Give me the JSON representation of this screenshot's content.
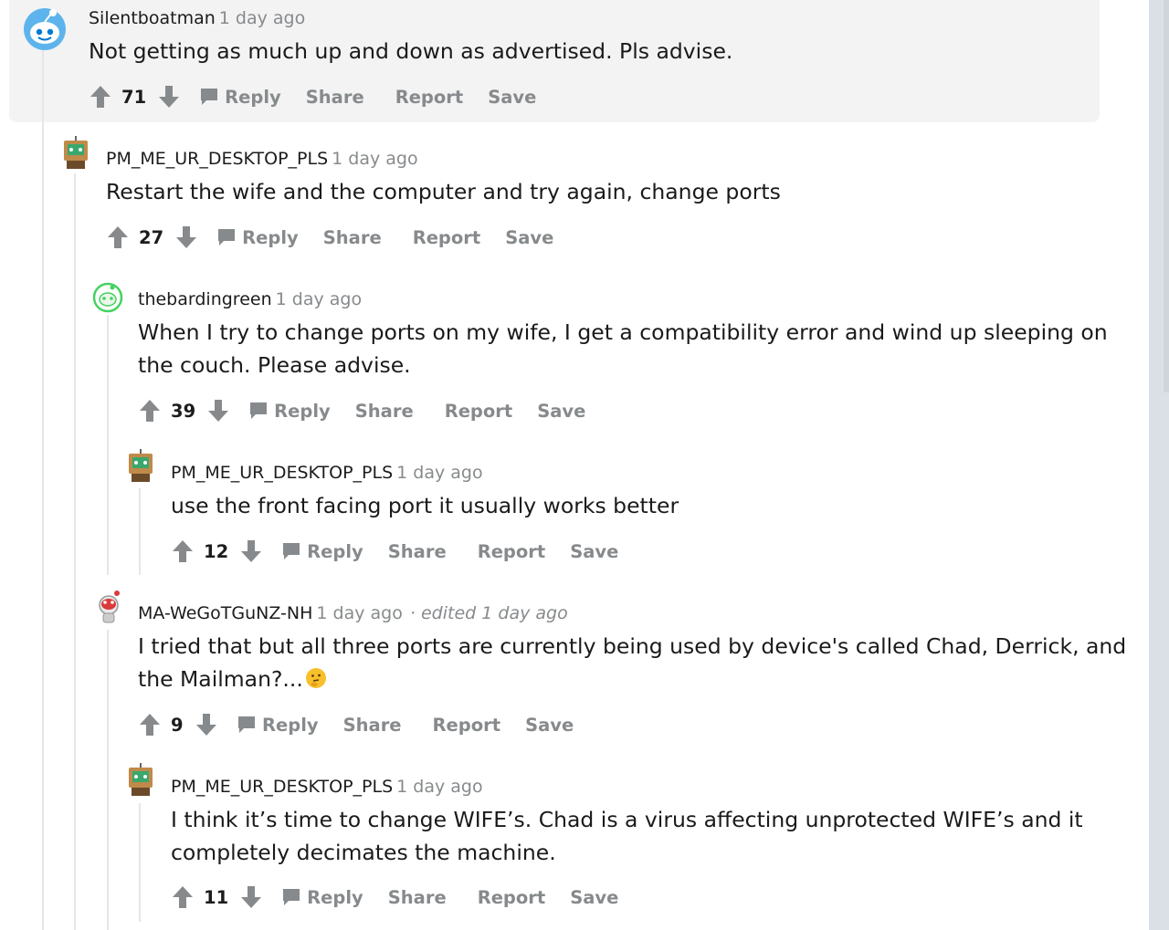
{
  "ui": {
    "reply_label": "Reply",
    "share_label": "Share",
    "report_label": "Report",
    "save_label": "Save",
    "upvote_icon": "upvote-arrow-icon",
    "downvote_icon": "downvote-arrow-icon",
    "reply_icon": "speech-bubble-icon",
    "colors": {
      "meta_gray": "#878a8c",
      "highlight_bg": "#f3f3f3",
      "gutter_bg": "#dae0e6"
    }
  },
  "comments": [
    {
      "author": "Silentboatman",
      "time": "1 day ago",
      "edited": "",
      "lines": [
        "Not getting as much up and down as advertised. Pls advise."
      ],
      "score": "71",
      "avatar": "snoo-blue-avatar"
    },
    {
      "author": "PM_ME_UR_DESKTOP_PLS",
      "time": "1 day ago",
      "edited": "",
      "lines": [
        "Restart the wife and the computer and try again, change ports"
      ],
      "score": "27",
      "avatar": "retro-computer-avatar"
    },
    {
      "author": "thebardingreen",
      "time": "1 day ago",
      "edited": "",
      "lines": [
        "When I try to change ports on my wife, I get a compatibility error and wind up sleeping on",
        "the couch. Please advise."
      ],
      "score": "39",
      "avatar": "snoo-green-avatar"
    },
    {
      "author": "PM_ME_UR_DESKTOP_PLS",
      "time": "1 day ago",
      "edited": "",
      "lines": [
        "use the front facing port it usually works better"
      ],
      "score": "12",
      "avatar": "retro-computer-avatar"
    },
    {
      "author": "MA-WeGoTGuNZ-NH",
      "time": "1 day ago",
      "edited": "· edited 1 day ago",
      "lines": [
        "I tried that but all three ports are currently being used by device's called Chad, Derrick, and",
        "the Mailman?..."
      ],
      "score": "9",
      "avatar": "snoo-red-avatar",
      "emoji": "thinking-face-emoji"
    },
    {
      "author": "PM_ME_UR_DESKTOP_PLS",
      "time": "1 day ago",
      "edited": "",
      "lines": [
        "I think it’s time to change WIFE’s. Chad is a virus affecting unprotected WIFE’s and it",
        "completely decimates the machine."
      ],
      "score": "11",
      "avatar": "retro-computer-avatar"
    }
  ]
}
